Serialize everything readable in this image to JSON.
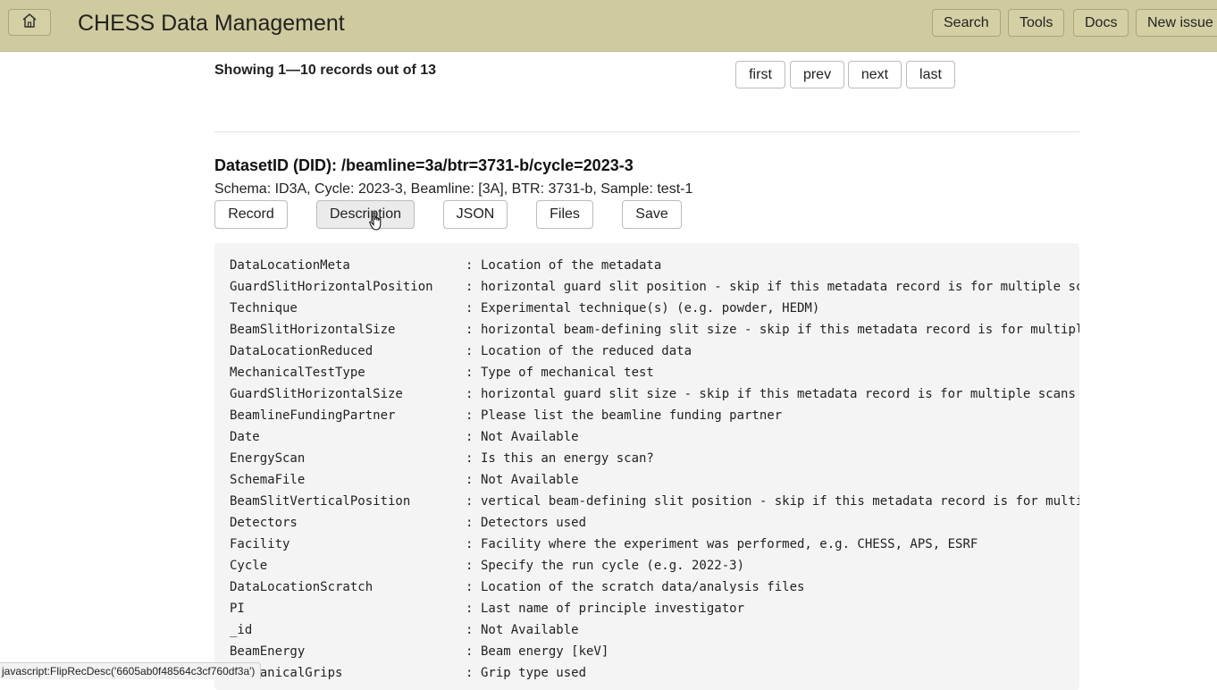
{
  "header": {
    "title": "CHESS Data Management",
    "nav": [
      {
        "label": "Search"
      },
      {
        "label": "Tools"
      },
      {
        "label": "Docs"
      },
      {
        "label": "New issue"
      }
    ]
  },
  "pagination": {
    "summary": "Showing 1—10 records out of 13",
    "buttons": [
      "first",
      "prev",
      "next",
      "last"
    ]
  },
  "record": {
    "did_title": "DatasetID (DID): /beamline=3a/btr=3731-b/cycle=2023-3",
    "schema_line": "Schema: ID3A, Cycle: 2023-3, Beamline: [3A], BTR: 3731-b, Sample: test-1",
    "actions": [
      "Record",
      "Description",
      "JSON",
      "Files",
      "Save"
    ],
    "active_action": "Description",
    "description": [
      {
        "key": "DataLocationMeta",
        "value": "Location of the metadata"
      },
      {
        "key": "GuardSlitHorizontalPosition",
        "value": "horizontal guard slit position - skip if this metadata record is for multiple scans"
      },
      {
        "key": "Technique",
        "value": "Experimental technique(s) (e.g. powder, HEDM)"
      },
      {
        "key": "BeamSlitHorizontalSize",
        "value": "horizontal beam-defining slit size - skip if this metadata record is for multiple scans"
      },
      {
        "key": "DataLocationReduced",
        "value": "Location of the reduced data"
      },
      {
        "key": "MechanicalTestType",
        "value": "Type of mechanical test"
      },
      {
        "key": "GuardSlitHorizontalSize",
        "value": "horizontal guard slit size - skip if this metadata record is for multiple scans"
      },
      {
        "key": "BeamlineFundingPartner",
        "value": "Please list the beamline funding partner"
      },
      {
        "key": "Date",
        "value": "Not Available"
      },
      {
        "key": "EnergyScan",
        "value": "Is this an energy scan?"
      },
      {
        "key": "SchemaFile",
        "value": "Not Available"
      },
      {
        "key": "BeamSlitVerticalPosition",
        "value": "vertical beam-defining slit position - skip if this metadata record is for multiple scans"
      },
      {
        "key": "Detectors",
        "value": "Detectors used"
      },
      {
        "key": "Facility",
        "value": "Facility where the experiment was performed, e.g. CHESS, APS, ESRF"
      },
      {
        "key": "Cycle",
        "value": "Specify the run cycle (e.g. 2022-3)"
      },
      {
        "key": "DataLocationScratch",
        "value": "Location of the scratch data/analysis files"
      },
      {
        "key": "PI",
        "value": "Last name of principle investigator"
      },
      {
        "key": "_id",
        "value": "Not Available"
      },
      {
        "key": "BeamEnergy",
        "value": "Beam energy [keV]"
      },
      {
        "key": "MechanicalGrips",
        "value": "Grip type used"
      }
    ]
  },
  "status_bar": {
    "text": "javascript:FlipRecDesc('6605ab0f48564c3cf760df3a')"
  },
  "colors": {
    "header_bg": "#cfcb9e",
    "desc_bg": "#f4f4f4"
  }
}
